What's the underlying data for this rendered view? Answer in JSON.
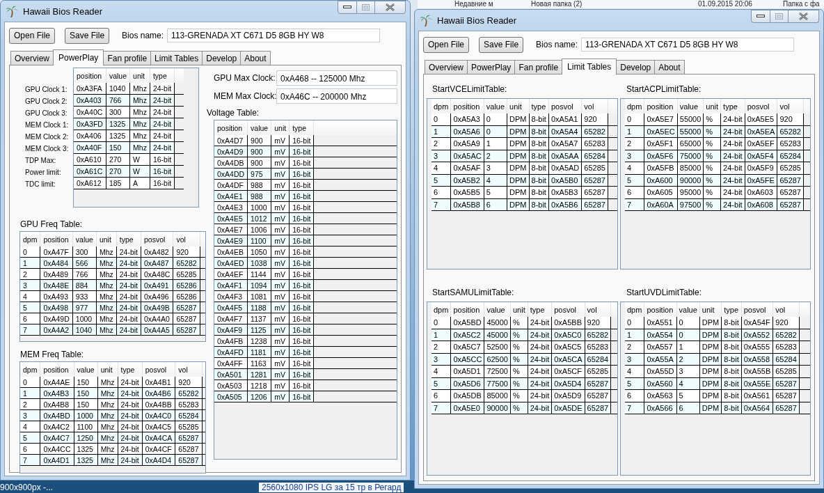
{
  "desktop": {
    "top_items": [
      "Недавние м",
      "Новая папка (2)",
      "01.09.2015 20:06",
      "Папка с фа"
    ],
    "bottom_items": [
      "900x900px -...",
      "2560x1080 IPS LG за 15 тр в Регард"
    ]
  },
  "windows": [
    {
      "title": "Hawaii Bios Reader",
      "buttons": [
        "Open File",
        "Save File"
      ],
      "bios_label": "Bios name:",
      "bios_value": "113-GRENADA XT C671 D5 8GB HY W8",
      "tabs": [
        {
          "label": "Overview",
          "selected": false
        },
        {
          "label": "PowerPlay",
          "selected": true
        },
        {
          "label": "Fan profile",
          "selected": false
        },
        {
          "label": "Limit Tables",
          "selected": false
        },
        {
          "label": "Develop",
          "selected": false
        },
        {
          "label": "About",
          "selected": false
        }
      ],
      "page": {
        "kind": "powerplay",
        "clocks": {
          "columns": [
            "position",
            "value",
            "unit",
            "type"
          ],
          "rows": [
            {
              "label": "GPU Clock 1:",
              "cells": [
                "0xA3FA",
                "1040",
                "Mhz",
                "24-bit"
              ]
            },
            {
              "label": "GPU Clock 2:",
              "cells": [
                "0xA403",
                "766",
                "Mhz",
                "24-bit"
              ]
            },
            {
              "label": "GPU Clock 3:",
              "cells": [
                "0xA40C",
                "300",
                "Mhz",
                "24-bit"
              ]
            },
            {
              "label": "MEM Clock 1:",
              "cells": [
                "0xA3FD",
                "1325",
                "Mhz",
                "24-bit"
              ]
            },
            {
              "label": "MEM Clock 2:",
              "cells": [
                "0xA406",
                "1325",
                "Mhz",
                "24-bit"
              ]
            },
            {
              "label": "MEM Clock 3:",
              "cells": [
                "0xA40F",
                "150",
                "Mhz",
                "24-bit"
              ]
            },
            {
              "label": "TDP Max:",
              "cells": [
                "0xA610",
                "270",
                "W",
                "16-bit"
              ]
            },
            {
              "label": "Power limit:",
              "cells": [
                "0xA61C",
                "270",
                "W",
                "16-bit"
              ]
            },
            {
              "label": "TDC limit:",
              "cells": [
                "0xA612",
                "185",
                "A",
                "16-bit"
              ]
            }
          ]
        },
        "max_clocks": [
          {
            "label": "GPU Max Clock:",
            "value": "0xA468 -- 125000 Mhz"
          },
          {
            "label": "MEM Max Clock:",
            "value": "0xA46C -- 200000 Mhz"
          }
        ],
        "voltage_table": {
          "title": "Voltage Table:",
          "columns": [
            "position",
            "value",
            "unit",
            "type"
          ],
          "rows": [
            [
              "0xA4D7",
              "900",
              "mV",
              "16-bit"
            ],
            [
              "0xA4D9",
              "900",
              "mV",
              "16-bit"
            ],
            [
              "0xA4DB",
              "900",
              "mV",
              "16-bit"
            ],
            [
              "0xA4DD",
              "975",
              "mV",
              "16-bit"
            ],
            [
              "0xA4DF",
              "988",
              "mV",
              "16-bit"
            ],
            [
              "0xA4E1",
              "988",
              "mV",
              "16-bit"
            ],
            [
              "0xA4E3",
              "1000",
              "mV",
              "16-bit"
            ],
            [
              "0xA4E5",
              "1012",
              "mV",
              "16-bit"
            ],
            [
              "0xA4E7",
              "1006",
              "mV",
              "16-bit"
            ],
            [
              "0xA4E9",
              "1100",
              "mV",
              "16-bit"
            ],
            [
              "0xA4EB",
              "1050",
              "mV",
              "16-bit"
            ],
            [
              "0xA4ED",
              "1038",
              "mV",
              "16-bit"
            ],
            [
              "0xA4EF",
              "1144",
              "mV",
              "16-bit"
            ],
            [
              "0xA4F1",
              "1094",
              "mV",
              "16-bit"
            ],
            [
              "0xA4F3",
              "1081",
              "mV",
              "16-bit"
            ],
            [
              "0xA4F5",
              "1188",
              "mV",
              "16-bit"
            ],
            [
              "0xA4F7",
              "1137",
              "mV",
              "16-bit"
            ],
            [
              "0xA4F9",
              "1125",
              "mV",
              "16-bit"
            ],
            [
              "0xA4FB",
              "1238",
              "mV",
              "16-bit"
            ],
            [
              "0xA4FD",
              "1181",
              "mV",
              "16-bit"
            ],
            [
              "0xA4FF",
              "1163",
              "mV",
              "16-bit"
            ],
            [
              "0xA501",
              "1281",
              "mV",
              "16-bit"
            ],
            [
              "0xA503",
              "1218",
              "mV",
              "16-bit"
            ],
            [
              "0xA505",
              "1206",
              "mV",
              "16-bit"
            ]
          ]
        },
        "freq_tables": [
          {
            "title": "GPU Freq Table:",
            "columns": [
              "dpm",
              "position",
              "value",
              "unit",
              "type",
              "posvol",
              "vol"
            ],
            "rows": [
              [
                "0",
                "0xA47F",
                "300",
                "Mhz",
                "24-bit",
                "0xA482",
                "920"
              ],
              [
                "1",
                "0xA484",
                "566",
                "Mhz",
                "24-bit",
                "0xA487",
                "65282"
              ],
              [
                "2",
                "0xA489",
                "766",
                "Mhz",
                "24-bit",
                "0xA48C",
                "65285"
              ],
              [
                "3",
                "0xA48E",
                "884",
                "Mhz",
                "24-bit",
                "0xA491",
                "65286"
              ],
              [
                "4",
                "0xA493",
                "933",
                "Mhz",
                "24-bit",
                "0xA496",
                "65286"
              ],
              [
                "5",
                "0xA498",
                "977",
                "Mhz",
                "24-bit",
                "0xA49B",
                "65287"
              ],
              [
                "6",
                "0xA49D",
                "1000",
                "Mhz",
                "24-bit",
                "0xA4A0",
                "65287"
              ],
              [
                "7",
                "0xA4A2",
                "1040",
                "Mhz",
                "24-bit",
                "0xA4A5",
                "65287"
              ]
            ]
          },
          {
            "title": "MEM Freq Table:",
            "columns": [
              "dpm",
              "position",
              "value",
              "unit",
              "type",
              "posvol",
              "vol"
            ],
            "rows": [
              [
                "0",
                "0xA4AE",
                "150",
                "Mhz",
                "24-bit",
                "0xA4B1",
                "920"
              ],
              [
                "1",
                "0xA4B3",
                "150",
                "Mhz",
                "24-bit",
                "0xA4B6",
                "65282"
              ],
              [
                "2",
                "0xA4B8",
                "150",
                "Mhz",
                "24-bit",
                "0xA4BB",
                "65283"
              ],
              [
                "3",
                "0xA4BD",
                "1000",
                "Mhz",
                "24-bit",
                "0xA4C0",
                "65284"
              ],
              [
                "4",
                "0xA4C2",
                "1100",
                "Mhz",
                "24-bit",
                "0xA4C5",
                "65285"
              ],
              [
                "5",
                "0xA4C7",
                "1250",
                "Mhz",
                "24-bit",
                "0xA4CA",
                "65287"
              ],
              [
                "6",
                "0xA4CC",
                "1325",
                "Mhz",
                "24-bit",
                "0xA4CF",
                "65287"
              ],
              [
                "7",
                "0xA4D1",
                "1325",
                "Mhz",
                "24-bit",
                "0xA4D4",
                "65287"
              ]
            ]
          }
        ]
      }
    },
    {
      "title": "Hawaii Bios Reader",
      "buttons": [
        "Open File",
        "Save File"
      ],
      "bios_label": "Bios name:",
      "bios_value": "113-GRENADA XT C671 D5 8GB HY W8",
      "tabs": [
        {
          "label": "Overview",
          "selected": false
        },
        {
          "label": "PowerPlay",
          "selected": false
        },
        {
          "label": "Fan profile",
          "selected": false
        },
        {
          "label": "Limit Tables",
          "selected": true
        },
        {
          "label": "Develop",
          "selected": false
        },
        {
          "label": "About",
          "selected": false
        }
      ],
      "page": {
        "kind": "limit_tables",
        "tables": [
          {
            "title": "StartVCELimitTable:",
            "columns": [
              "dpm",
              "position",
              "value",
              "unit",
              "type",
              "posvol",
              "vol"
            ],
            "rows": [
              [
                "0",
                "0xA5A3",
                "0",
                "DPM",
                "8-bit",
                "0xA5A1",
                "920"
              ],
              [
                "1",
                "0xA5A6",
                "0",
                "DPM",
                "8-bit",
                "0xA5A4",
                "65282"
              ],
              [
                "2",
                "0xA5A9",
                "1",
                "DPM",
                "8-bit",
                "0xA5A7",
                "65283"
              ],
              [
                "3",
                "0xA5AC",
                "2",
                "DPM",
                "8-bit",
                "0xA5AA",
                "65284"
              ],
              [
                "4",
                "0xA5AF",
                "3",
                "DPM",
                "8-bit",
                "0xA5AD",
                "65285"
              ],
              [
                "5",
                "0xA5B2",
                "4",
                "DPM",
                "8-bit",
                "0xA5B0",
                "65287"
              ],
              [
                "6",
                "0xA5B5",
                "5",
                "DPM",
                "8-bit",
                "0xA5B3",
                "65287"
              ],
              [
                "7",
                "0xA5B8",
                "6",
                "DPM",
                "8-bit",
                "0xA5B6",
                "65287"
              ]
            ]
          },
          {
            "title": "StartACPLimitTable:",
            "columns": [
              "dpm",
              "position",
              "value",
              "unit",
              "type",
              "posvol",
              "vol"
            ],
            "rows": [
              [
                "0",
                "0xA5E7",
                "55000",
                "%",
                "24-bit",
                "0xA5E5",
                "920"
              ],
              [
                "1",
                "0xA5EC",
                "55000",
                "%",
                "24-bit",
                "0xA5EA",
                "65282"
              ],
              [
                "2",
                "0xA5F1",
                "65000",
                "%",
                "24-bit",
                "0xA5EF",
                "65283"
              ],
              [
                "3",
                "0xA5F6",
                "75000",
                "%",
                "24-bit",
                "0xA5F4",
                "65284"
              ],
              [
                "4",
                "0xA5FB",
                "85000",
                "%",
                "24-bit",
                "0xA5F9",
                "65285"
              ],
              [
                "5",
                "0xA600",
                "90000",
                "%",
                "24-bit",
                "0xA5FE",
                "65287"
              ],
              [
                "6",
                "0xA605",
                "95000",
                "%",
                "24-bit",
                "0xA603",
                "65287"
              ],
              [
                "7",
                "0xA60A",
                "97500",
                "%",
                "24-bit",
                "0xA608",
                "65287"
              ]
            ]
          },
          {
            "title": "StartSAMULimitTable:",
            "columns": [
              "dpm",
              "position",
              "value",
              "unit",
              "type",
              "posvol",
              "vol"
            ],
            "rows": [
              [
                "0",
                "0xA5BD",
                "45000",
                "%",
                "24-bit",
                "0xA5BB",
                "920"
              ],
              [
                "1",
                "0xA5C2",
                "45000",
                "%",
                "24-bit",
                "0xA5C0",
                "65282"
              ],
              [
                "2",
                "0xA5C7",
                "52500",
                "%",
                "24-bit",
                "0xA5C5",
                "65283"
              ],
              [
                "3",
                "0xA5CC",
                "62500",
                "%",
                "24-bit",
                "0xA5CA",
                "65284"
              ],
              [
                "4",
                "0xA5D1",
                "72500",
                "%",
                "24-bit",
                "0xA5CF",
                "65285"
              ],
              [
                "5",
                "0xA5D6",
                "77500",
                "%",
                "24-bit",
                "0xA5D4",
                "65287"
              ],
              [
                "6",
                "0xA5DB",
                "85000",
                "%",
                "24-bit",
                "0xA5D9",
                "65287"
              ],
              [
                "7",
                "0xA5E0",
                "90000",
                "%",
                "24-bit",
                "0xA5DE",
                "65287"
              ]
            ]
          },
          {
            "title": "StartUVDLimitTable:",
            "columns": [
              "dpm",
              "position",
              "value",
              "unit",
              "type",
              "posvol",
              "vol"
            ],
            "rows": [
              [
                "0",
                "0xA551",
                "0",
                "DPM",
                "8-bit",
                "0xA54F",
                "920"
              ],
              [
                "1",
                "0xA554",
                "0",
                "DPM",
                "8-bit",
                "0xA552",
                "65282"
              ],
              [
                "2",
                "0xA557",
                "1",
                "DPM",
                "8-bit",
                "0xA555",
                "65283"
              ],
              [
                "3",
                "0xA55A",
                "2",
                "DPM",
                "8-bit",
                "0xA558",
                "65284"
              ],
              [
                "4",
                "0xA55D",
                "3",
                "DPM",
                "8-bit",
                "0xA55B",
                "65285"
              ],
              [
                "5",
                "0xA560",
                "4",
                "DPM",
                "8-bit",
                "0xA55E",
                "65287"
              ],
              [
                "6",
                "0xA563",
                "5",
                "DPM",
                "8-bit",
                "0xA561",
                "65287"
              ],
              [
                "7",
                "0xA566",
                "6",
                "DPM",
                "8-bit",
                "0xA564",
                "65287"
              ]
            ]
          }
        ]
      }
    }
  ]
}
